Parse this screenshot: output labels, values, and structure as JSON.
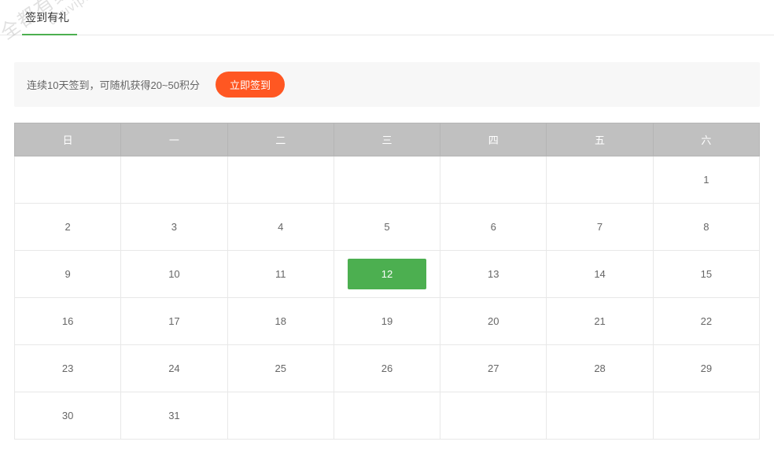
{
  "tab": {
    "label": "签到有礼"
  },
  "notice": {
    "text": "连续10天签到，可随机获得20~50积分",
    "button": "立即签到"
  },
  "weekdays": [
    "日",
    "一",
    "二",
    "三",
    "四",
    "五",
    "六"
  ],
  "calendar": {
    "highlight_day": 12,
    "rows": [
      [
        null,
        null,
        null,
        null,
        null,
        null,
        1
      ],
      [
        2,
        3,
        4,
        5,
        6,
        7,
        8
      ],
      [
        9,
        10,
        11,
        12,
        13,
        14,
        15
      ],
      [
        16,
        17,
        18,
        19,
        20,
        21,
        22
      ],
      [
        23,
        24,
        25,
        26,
        27,
        28,
        29
      ],
      [
        30,
        31,
        null,
        null,
        null,
        null,
        null
      ]
    ]
  },
  "watermark": {
    "line1": "全都有综合资源网",
    "line2": "douvip.com"
  }
}
